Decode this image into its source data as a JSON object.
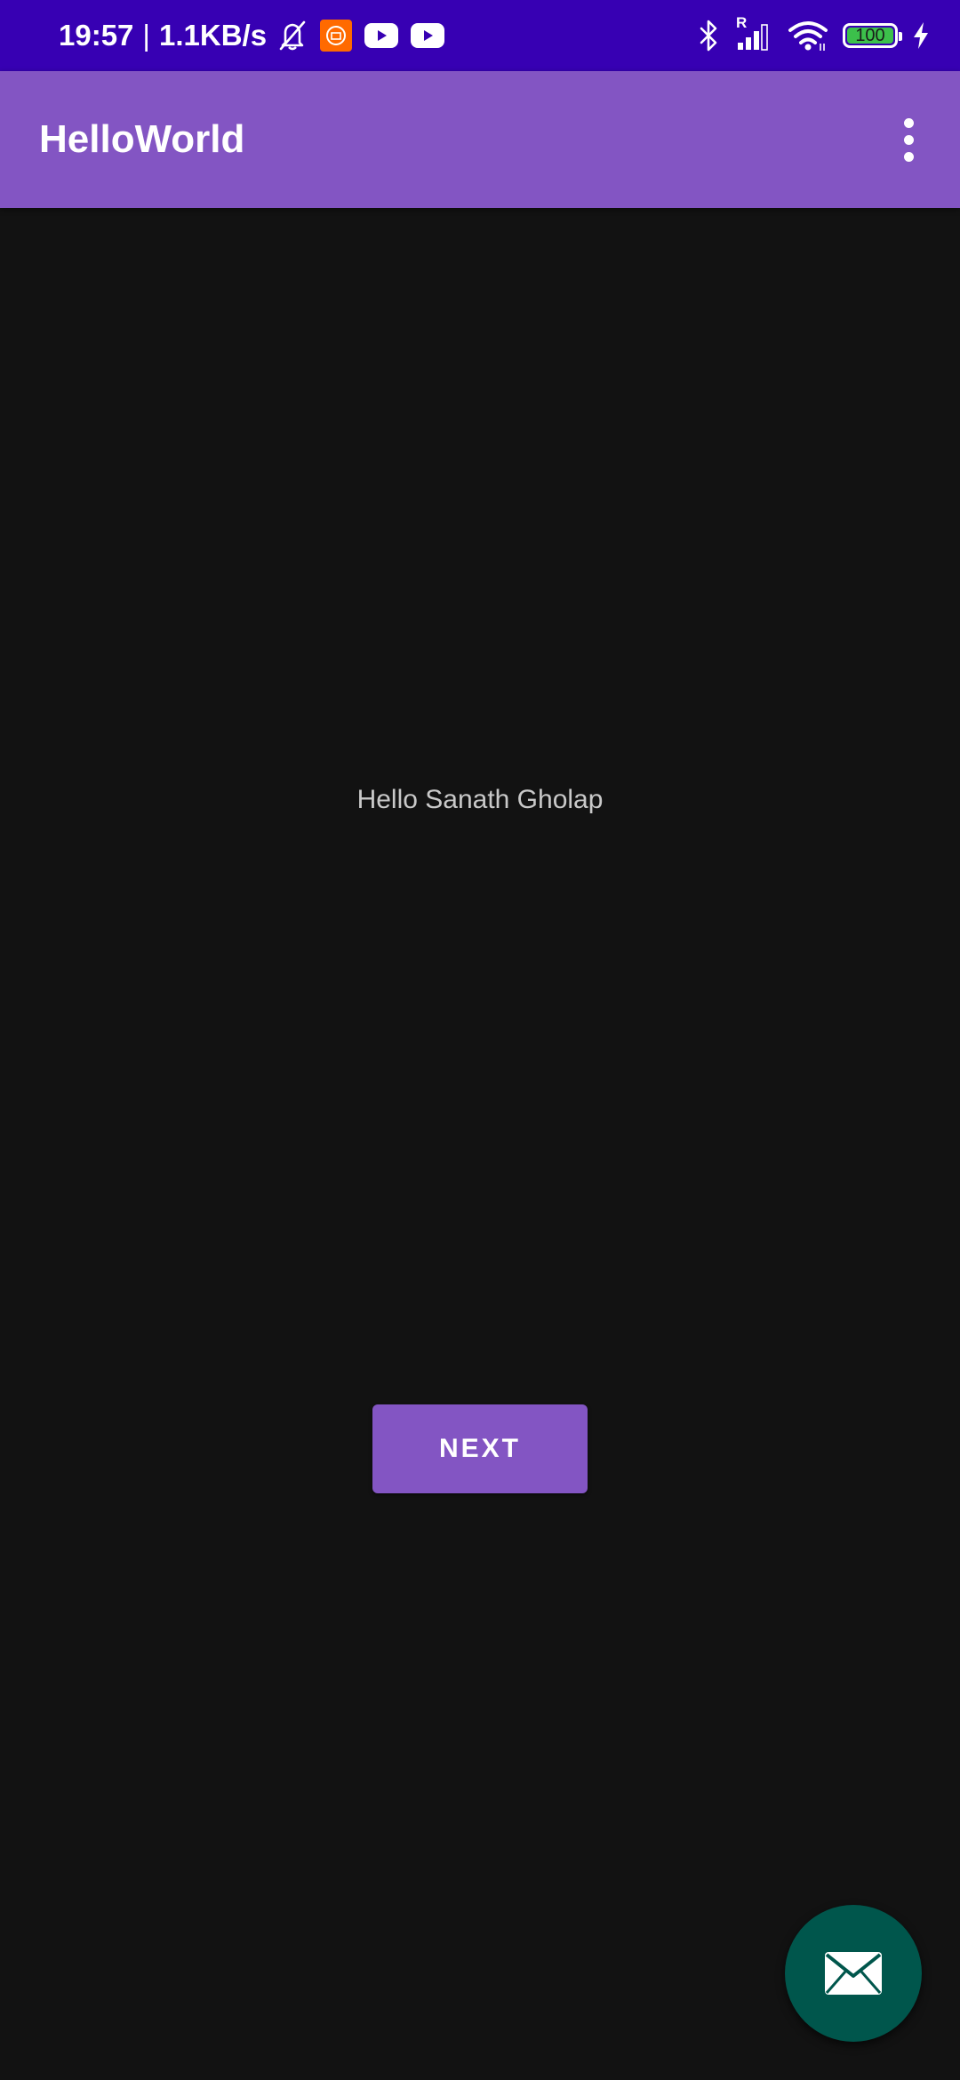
{
  "status_bar": {
    "time": "19:57",
    "separator": "|",
    "network_speed": "1.1KB/s",
    "battery_level": "100",
    "icons_left": [
      "bell-off-icon",
      "mi-app-icon",
      "youtube-icon",
      "youtube-icon"
    ],
    "icons_right": [
      "bluetooth-icon",
      "signal-roaming-icon",
      "wifi-icon",
      "battery-icon",
      "charging-icon"
    ],
    "roaming_label": "R",
    "background_color": "#3700b3"
  },
  "app_bar": {
    "title": "HelloWorld",
    "overflow_icon": "more-vert-icon",
    "background_color": "#8355c3"
  },
  "main": {
    "greeting": "Hello Sanath Gholap",
    "next_label": "NEXT"
  },
  "fab": {
    "icon": "mail-icon",
    "background_color": "#00564c"
  },
  "colors": {
    "background": "#121212",
    "accent": "#8355c3"
  }
}
